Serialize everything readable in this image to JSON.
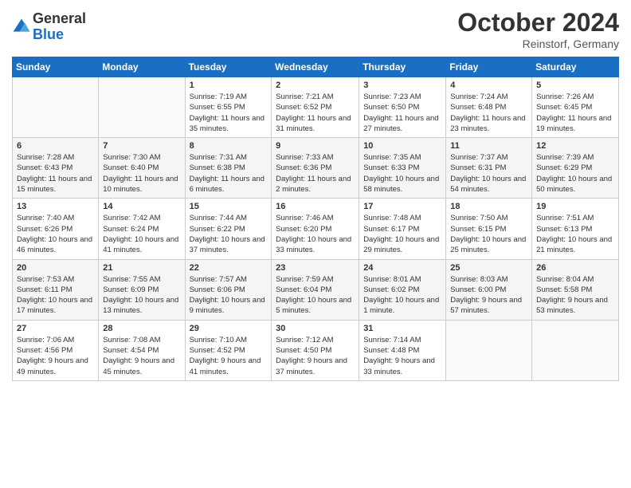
{
  "logo": {
    "general": "General",
    "blue": "Blue"
  },
  "header": {
    "title": "October 2024",
    "subtitle": "Reinstorf, Germany"
  },
  "days": [
    "Sunday",
    "Monday",
    "Tuesday",
    "Wednesday",
    "Thursday",
    "Friday",
    "Saturday"
  ],
  "weeks": [
    [
      {
        "num": "",
        "content": ""
      },
      {
        "num": "",
        "content": ""
      },
      {
        "num": "1",
        "content": "Sunrise: 7:19 AM\nSunset: 6:55 PM\nDaylight: 11 hours and 35 minutes."
      },
      {
        "num": "2",
        "content": "Sunrise: 7:21 AM\nSunset: 6:52 PM\nDaylight: 11 hours and 31 minutes."
      },
      {
        "num": "3",
        "content": "Sunrise: 7:23 AM\nSunset: 6:50 PM\nDaylight: 11 hours and 27 minutes."
      },
      {
        "num": "4",
        "content": "Sunrise: 7:24 AM\nSunset: 6:48 PM\nDaylight: 11 hours and 23 minutes."
      },
      {
        "num": "5",
        "content": "Sunrise: 7:26 AM\nSunset: 6:45 PM\nDaylight: 11 hours and 19 minutes."
      }
    ],
    [
      {
        "num": "6",
        "content": "Sunrise: 7:28 AM\nSunset: 6:43 PM\nDaylight: 11 hours and 15 minutes."
      },
      {
        "num": "7",
        "content": "Sunrise: 7:30 AM\nSunset: 6:40 PM\nDaylight: 11 hours and 10 minutes."
      },
      {
        "num": "8",
        "content": "Sunrise: 7:31 AM\nSunset: 6:38 PM\nDaylight: 11 hours and 6 minutes."
      },
      {
        "num": "9",
        "content": "Sunrise: 7:33 AM\nSunset: 6:36 PM\nDaylight: 11 hours and 2 minutes."
      },
      {
        "num": "10",
        "content": "Sunrise: 7:35 AM\nSunset: 6:33 PM\nDaylight: 10 hours and 58 minutes."
      },
      {
        "num": "11",
        "content": "Sunrise: 7:37 AM\nSunset: 6:31 PM\nDaylight: 10 hours and 54 minutes."
      },
      {
        "num": "12",
        "content": "Sunrise: 7:39 AM\nSunset: 6:29 PM\nDaylight: 10 hours and 50 minutes."
      }
    ],
    [
      {
        "num": "13",
        "content": "Sunrise: 7:40 AM\nSunset: 6:26 PM\nDaylight: 10 hours and 46 minutes."
      },
      {
        "num": "14",
        "content": "Sunrise: 7:42 AM\nSunset: 6:24 PM\nDaylight: 10 hours and 41 minutes."
      },
      {
        "num": "15",
        "content": "Sunrise: 7:44 AM\nSunset: 6:22 PM\nDaylight: 10 hours and 37 minutes."
      },
      {
        "num": "16",
        "content": "Sunrise: 7:46 AM\nSunset: 6:20 PM\nDaylight: 10 hours and 33 minutes."
      },
      {
        "num": "17",
        "content": "Sunrise: 7:48 AM\nSunset: 6:17 PM\nDaylight: 10 hours and 29 minutes."
      },
      {
        "num": "18",
        "content": "Sunrise: 7:50 AM\nSunset: 6:15 PM\nDaylight: 10 hours and 25 minutes."
      },
      {
        "num": "19",
        "content": "Sunrise: 7:51 AM\nSunset: 6:13 PM\nDaylight: 10 hours and 21 minutes."
      }
    ],
    [
      {
        "num": "20",
        "content": "Sunrise: 7:53 AM\nSunset: 6:11 PM\nDaylight: 10 hours and 17 minutes."
      },
      {
        "num": "21",
        "content": "Sunrise: 7:55 AM\nSunset: 6:09 PM\nDaylight: 10 hours and 13 minutes."
      },
      {
        "num": "22",
        "content": "Sunrise: 7:57 AM\nSunset: 6:06 PM\nDaylight: 10 hours and 9 minutes."
      },
      {
        "num": "23",
        "content": "Sunrise: 7:59 AM\nSunset: 6:04 PM\nDaylight: 10 hours and 5 minutes."
      },
      {
        "num": "24",
        "content": "Sunrise: 8:01 AM\nSunset: 6:02 PM\nDaylight: 10 hours and 1 minute."
      },
      {
        "num": "25",
        "content": "Sunrise: 8:03 AM\nSunset: 6:00 PM\nDaylight: 9 hours and 57 minutes."
      },
      {
        "num": "26",
        "content": "Sunrise: 8:04 AM\nSunset: 5:58 PM\nDaylight: 9 hours and 53 minutes."
      }
    ],
    [
      {
        "num": "27",
        "content": "Sunrise: 7:06 AM\nSunset: 4:56 PM\nDaylight: 9 hours and 49 minutes."
      },
      {
        "num": "28",
        "content": "Sunrise: 7:08 AM\nSunset: 4:54 PM\nDaylight: 9 hours and 45 minutes."
      },
      {
        "num": "29",
        "content": "Sunrise: 7:10 AM\nSunset: 4:52 PM\nDaylight: 9 hours and 41 minutes."
      },
      {
        "num": "30",
        "content": "Sunrise: 7:12 AM\nSunset: 4:50 PM\nDaylight: 9 hours and 37 minutes."
      },
      {
        "num": "31",
        "content": "Sunrise: 7:14 AM\nSunset: 4:48 PM\nDaylight: 9 hours and 33 minutes."
      },
      {
        "num": "",
        "content": ""
      },
      {
        "num": "",
        "content": ""
      }
    ]
  ]
}
